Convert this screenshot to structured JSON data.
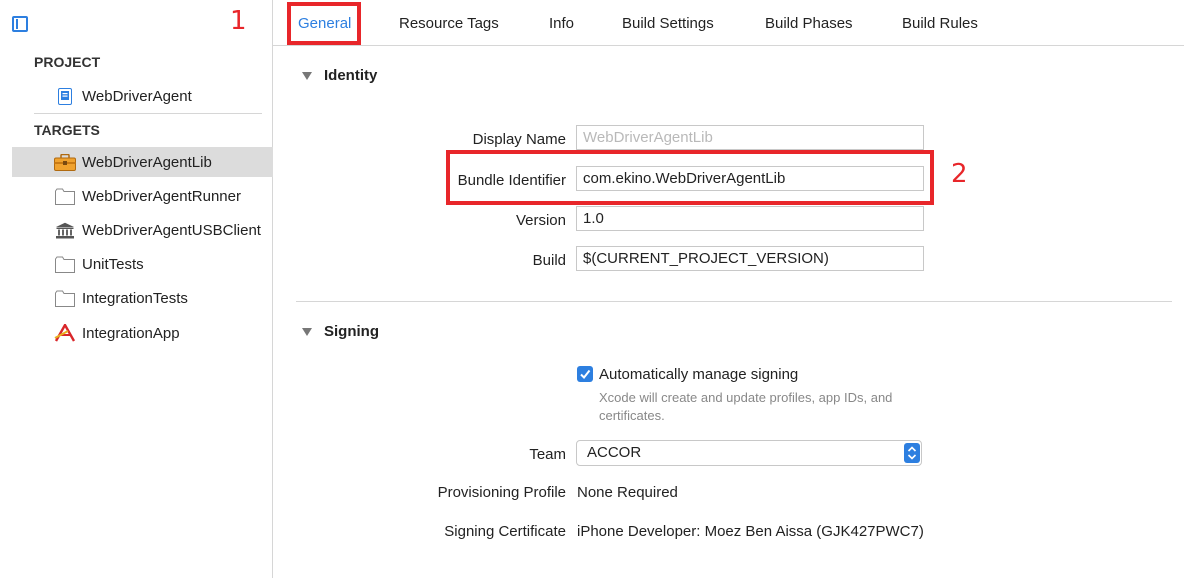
{
  "sidebar": {
    "project_header": "PROJECT",
    "project_item": "WebDriverAgent",
    "targets_header": "TARGETS",
    "targets": [
      {
        "label": "WebDriverAgentLib",
        "icon": "toolbox-icon"
      },
      {
        "label": "WebDriverAgentRunner",
        "icon": "folder-icon"
      },
      {
        "label": "WebDriverAgentUSBClient",
        "icon": "bank-icon"
      },
      {
        "label": "UnitTests",
        "icon": "folder-icon"
      },
      {
        "label": "IntegrationTests",
        "icon": "folder-icon"
      },
      {
        "label": "IntegrationApp",
        "icon": "app-icon"
      }
    ]
  },
  "tabs": [
    "General",
    "Resource Tags",
    "Info",
    "Build Settings",
    "Build Phases",
    "Build Rules"
  ],
  "annotations": [
    "1",
    "2"
  ],
  "identity": {
    "title": "Identity",
    "display_name_label": "Display Name",
    "display_name_placeholder": "WebDriverAgentLib",
    "bundle_identifier_label": "Bundle Identifier",
    "bundle_identifier_value": "com.ekino.WebDriverAgentLib",
    "version_label": "Version",
    "version_value": "1.0",
    "build_label": "Build",
    "build_value": "$(CURRENT_PROJECT_VERSION)"
  },
  "signing": {
    "title": "Signing",
    "auto_manage_label": "Automatically manage signing",
    "auto_manage_help": "Xcode will create and update profiles, app IDs, and certificates.",
    "team_label": "Team",
    "team_value": "ACCOR",
    "provisioning_label": "Provisioning Profile",
    "provisioning_value": "None Required",
    "certificate_label": "Signing Certificate",
    "certificate_value": "iPhone Developer: Moez Ben Aissa (GJK427PWC7)"
  },
  "colors": {
    "accent": "#2d7fe0",
    "annotation": "#e8262a",
    "selection": "#dcdcdc"
  }
}
